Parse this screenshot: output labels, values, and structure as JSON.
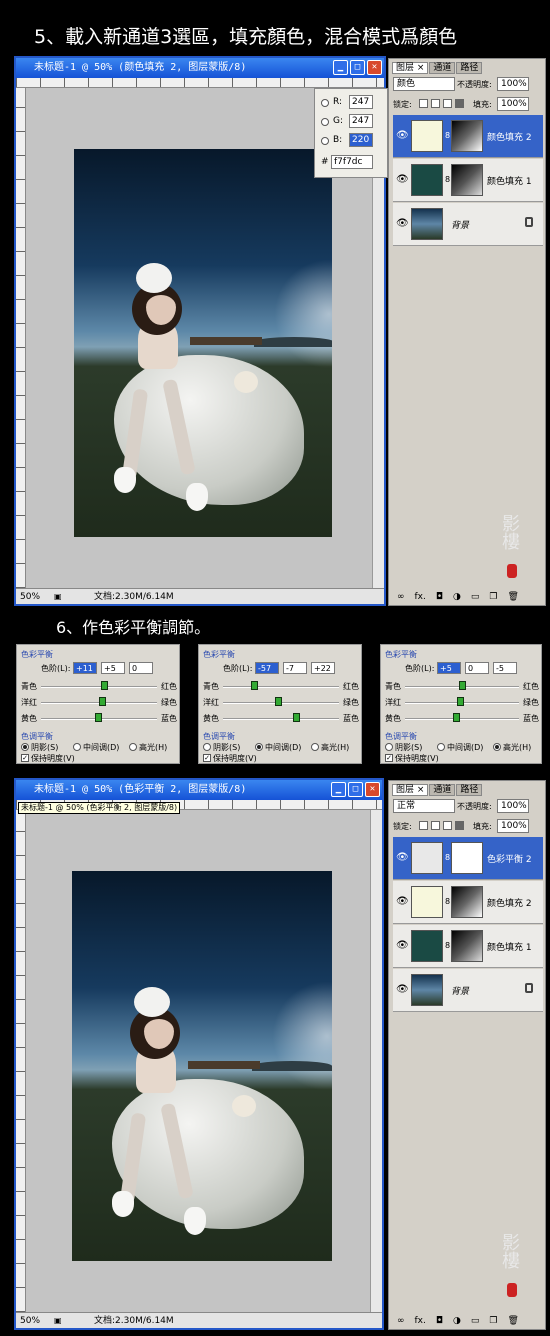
{
  "step5": {
    "heading": "5、載入新通道3選區，填充顏色，混合模式爲顏色"
  },
  "step6": {
    "heading": "6、作色彩平衡調節。"
  },
  "window1": {
    "title": "未标题-1 @ 50% (颜色填充 2, 图层蒙版/8)",
    "zoom": "50%",
    "doc": "文档:2.30M/6.14M",
    "color_picker": {
      "r_label": "R:",
      "r": "247",
      "g_label": "G:",
      "g": "247",
      "b_label": "B:",
      "b": "220",
      "hash": "#",
      "hex": "f7f7dc"
    }
  },
  "window2": {
    "title": "未标题-1 @ 50% (色彩平衡 2, 图层蒙版/8)",
    "tooltip": "未标题-1 @ 50% (色彩平衡 2, 图层蒙版/8)",
    "zoom": "50%",
    "doc": "文档:2.30M/6.14M"
  },
  "layers_panel1": {
    "tabs": [
      "图层 ×",
      "通道",
      "路径"
    ],
    "blend_mode": "颜色",
    "opacity_label": "不透明度:",
    "opacity": "100%",
    "lock_label": "锁定:",
    "fill_label": "填充:",
    "fill": "100%",
    "layers": [
      {
        "name": "颜色填充 2",
        "selected": true,
        "thumb_color": "#f7f7dc"
      },
      {
        "name": "颜色填充 1",
        "selected": false,
        "thumb_color": "#1a4a44"
      },
      {
        "name": "背景",
        "selected": false,
        "thumb_color": "#3a5068"
      }
    ],
    "footer_icons": [
      "link-icon",
      "fx-icon",
      "mask-icon",
      "adjustment-icon",
      "folder-icon",
      "new-layer-icon",
      "trash-icon"
    ],
    "footer_fx": "fx."
  },
  "layers_panel2": {
    "tabs": [
      "图层 ×",
      "通道",
      "路径"
    ],
    "blend_mode": "正常",
    "opacity_label": "不透明度:",
    "opacity": "100%",
    "lock_label": "锁定:",
    "fill_label": "填充:",
    "fill": "100%",
    "layers": [
      {
        "name": "色彩平衡 2",
        "selected": true,
        "thumb_color": "#ffffff"
      },
      {
        "name": "颜色填充 2",
        "selected": false,
        "thumb_color": "#f7f7dc"
      },
      {
        "name": "颜色填充 1",
        "selected": false,
        "thumb_color": "#1a4a44"
      },
      {
        "name": "背景",
        "selected": false,
        "thumb_color": "#3a5068"
      }
    ],
    "footer_fx": "fx."
  },
  "color_balance": [
    {
      "group": "色彩平衡",
      "levels_label": "色阶(L):",
      "values": [
        "+11",
        "+5",
        "0"
      ],
      "highlight": 0,
      "sliders": [
        {
          "left": "青色",
          "right": "红色",
          "level": 0.61
        },
        {
          "left": "洋红",
          "right": "绿色",
          "level": 0.58
        },
        {
          "left": "黄色",
          "right": "蓝色",
          "level": 0.55
        }
      ],
      "tone_group": "色调平衡",
      "tones": [
        "阴影(S)",
        "中间调(D)",
        "高光(H)"
      ],
      "tone_selected": 0,
      "preserve": "保持明度(V)"
    },
    {
      "group": "色彩平衡",
      "levels_label": "色阶(L):",
      "values": [
        "-57",
        "-7",
        "+22"
      ],
      "highlight": 0,
      "sliders": [
        {
          "left": "青色",
          "right": "红色",
          "level": 0.33
        },
        {
          "left": "洋红",
          "right": "绿色",
          "level": 0.5
        },
        {
          "left": "黄色",
          "right": "蓝色",
          "level": 0.65
        }
      ],
      "tone_group": "色调平衡",
      "tones": [
        "阴影(S)",
        "中间调(D)",
        "高光(H)"
      ],
      "tone_selected": 1,
      "preserve": "保持明度(V)"
    },
    {
      "group": "色彩平衡",
      "levels_label": "色阶(L):",
      "values": [
        "+5",
        "0",
        "-5"
      ],
      "highlight": 0,
      "sliders": [
        {
          "left": "青色",
          "right": "红色",
          "level": 0.53
        },
        {
          "left": "洋红",
          "right": "绿色",
          "level": 0.5
        },
        {
          "left": "黄色",
          "right": "蓝色",
          "level": 0.47
        }
      ],
      "tone_group": "色调平衡",
      "tones": [
        "阴影(S)",
        "中间调(D)",
        "高光(H)"
      ],
      "tone_selected": 2,
      "preserve": "保持明度(V)"
    }
  ]
}
